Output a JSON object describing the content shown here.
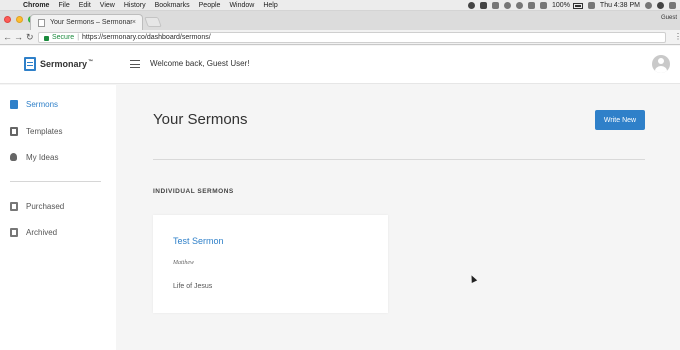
{
  "menubar": {
    "app": "Chrome",
    "items": [
      "File",
      "Edit",
      "View",
      "History",
      "Bookmarks",
      "People",
      "Window",
      "Help"
    ],
    "battery": "100%",
    "clock": "Thu 4:38 PM"
  },
  "browser": {
    "tab_title": "Your Sermons – Sermonary",
    "tab_close": "×",
    "profile": "Guest",
    "secure_label": "Secure",
    "url": "https://sermonary.co/dashboard/sermons/"
  },
  "header": {
    "brand": "Sermonary",
    "welcome": "Welcome back, Guest User!"
  },
  "sidebar": {
    "items": [
      {
        "label": "Sermons",
        "icon": "book-icon"
      },
      {
        "label": "Templates",
        "icon": "templates-icon"
      },
      {
        "label": "My Ideas",
        "icon": "lightbulb-icon"
      },
      {
        "label": "Purchased",
        "icon": "purchased-icon"
      },
      {
        "label": "Archived",
        "icon": "archive-icon"
      }
    ]
  },
  "main": {
    "title": "Your Sermons",
    "write_button": "Write New",
    "section_heading": "INDIVIDUAL SERMONS",
    "sermon": {
      "title": "Test Sermon",
      "passage": "Matthew",
      "series": "Life of Jesus"
    }
  },
  "colors": {
    "accent": "#2f80c9",
    "background": "#f5f5f5"
  }
}
